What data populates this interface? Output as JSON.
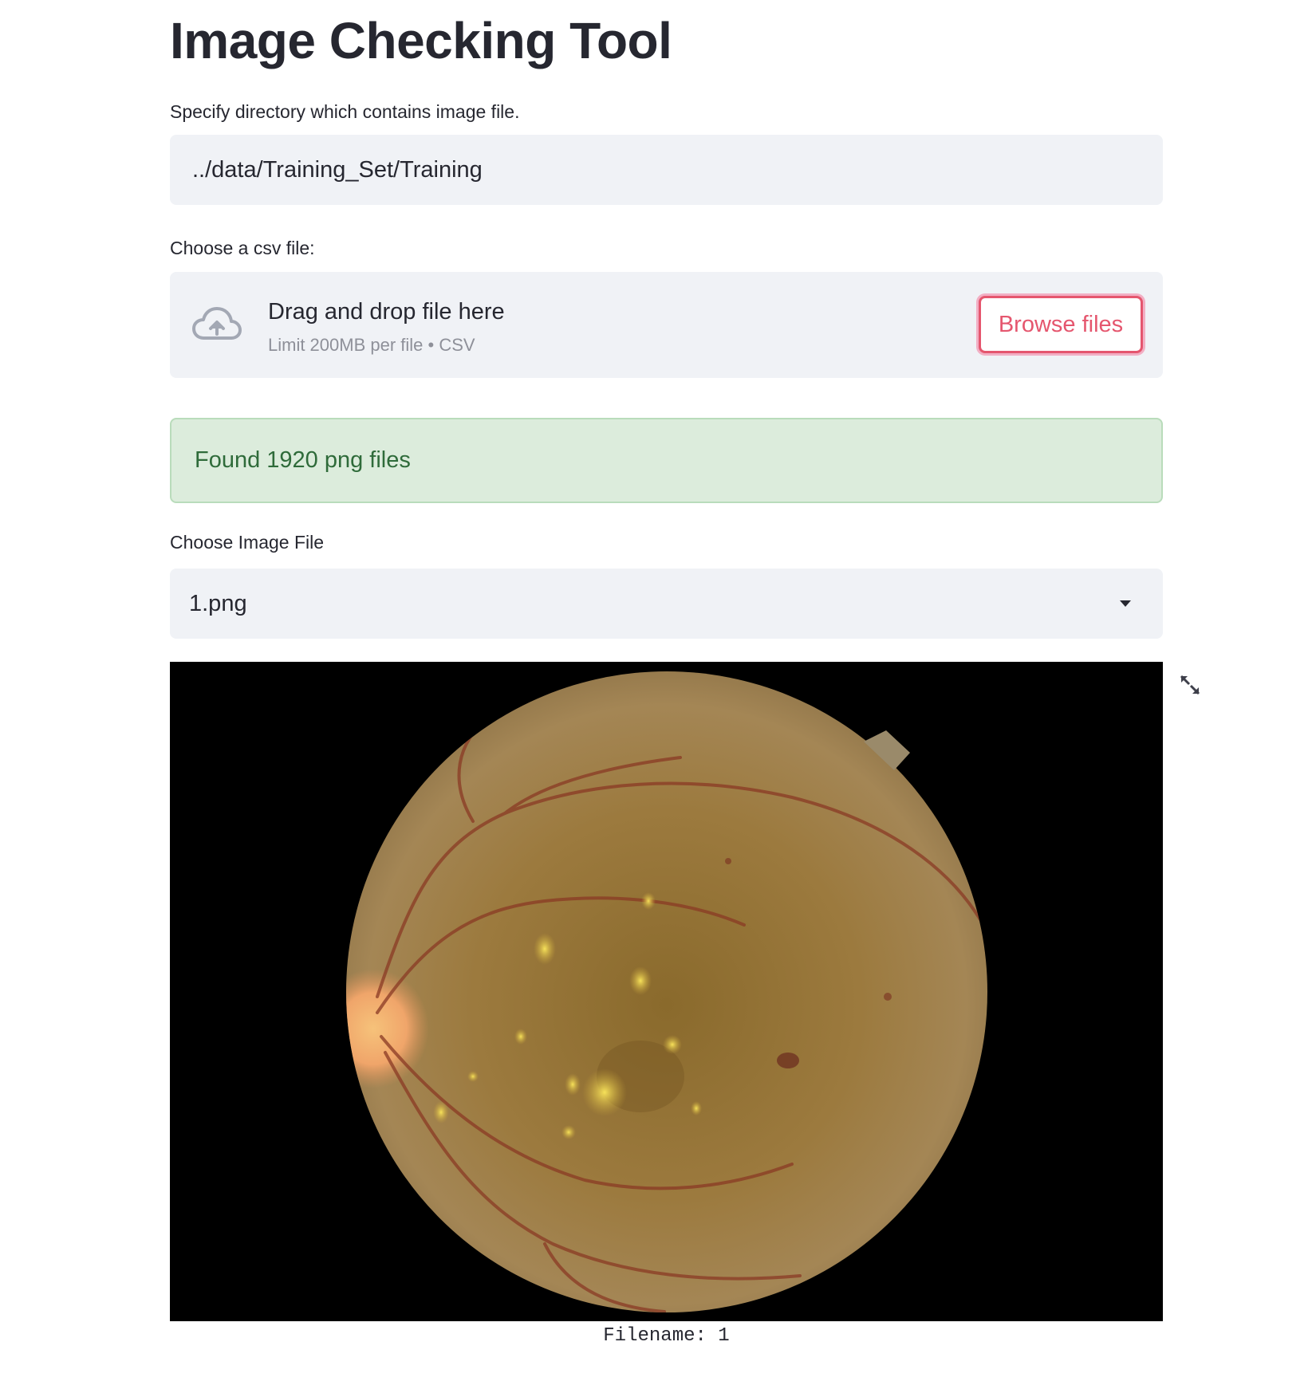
{
  "page": {
    "title": "Image Checking Tool"
  },
  "directory_input": {
    "label": "Specify directory which contains image file.",
    "value": "../data/Training_Set/Training"
  },
  "csv_uploader": {
    "label": "Choose a csv file:",
    "drop_text": "Drag and drop file here",
    "limit_text": "Limit 200MB per file • CSV",
    "browse_label": "Browse files",
    "icon": "cloud-upload-icon"
  },
  "status": {
    "message": "Found 1920 png files",
    "color": "#2f6b3a"
  },
  "image_select": {
    "label": "Choose Image File",
    "selected": "1.png",
    "icon": "chevron-down-icon"
  },
  "image_viewer": {
    "caption": "Filename: 1",
    "image": "retinal-fundus-photograph",
    "expand_icon": "fullscreen-icon"
  },
  "colors": {
    "accent": "#e5566e",
    "input_background": "#f0f2f6",
    "success_background": "#dcecdc",
    "text": "#262730"
  }
}
